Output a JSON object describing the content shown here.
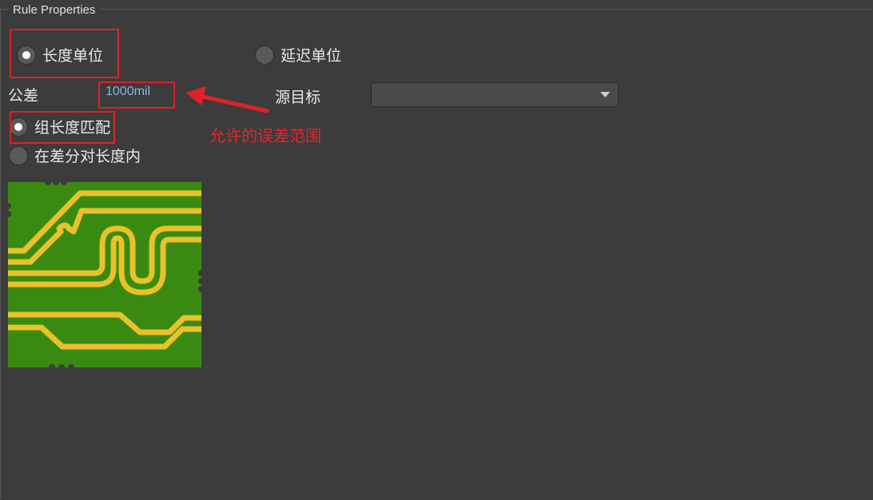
{
  "group": {
    "title": "Rule Properties"
  },
  "units": {
    "length": {
      "label": "长度单位",
      "checked": true
    },
    "delay": {
      "label": "延迟单位",
      "checked": false
    }
  },
  "tolerance": {
    "label": "公差",
    "value": "1000mil"
  },
  "target": {
    "label": "源目标",
    "selected": ""
  },
  "match_mode": {
    "group_length": {
      "label": "组长度匹配",
      "checked": true
    },
    "within_diff_pair": {
      "label": "在差分对长度内",
      "checked": false
    }
  },
  "annotation": {
    "text": "允许的误差范围",
    "color": "#e8232c"
  },
  "colors": {
    "board": "#3a8a12",
    "trace": "#e8c22a",
    "background": "#3c3c3c"
  },
  "preview": {
    "icon": "pcb-trace-preview"
  }
}
